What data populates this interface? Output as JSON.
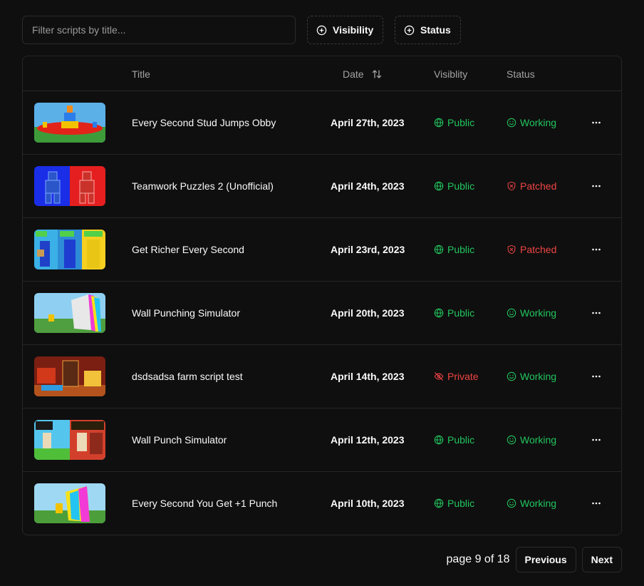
{
  "filters": {
    "search_placeholder": "Filter scripts by title...",
    "visibility_label": "Visibility",
    "status_label": "Status"
  },
  "table": {
    "headers": {
      "title": "Title",
      "date": "Date",
      "visibility": "Visiblity",
      "status": "Status"
    },
    "rows": [
      {
        "title": "Every Second Stud Jumps Obby",
        "date": "April 27th, 2023",
        "visibility": "Public",
        "status": "Working",
        "thumb": "stud-obby-thumbnail"
      },
      {
        "title": "Teamwork Puzzles 2 (Unofficial)",
        "date": "April 24th, 2023",
        "visibility": "Public",
        "status": "Patched",
        "thumb": "teamwork-puzzles-thumbnail"
      },
      {
        "title": "Get Richer Every Second",
        "date": "April 23rd, 2023",
        "visibility": "Public",
        "status": "Patched",
        "thumb": "get-richer-thumbnail"
      },
      {
        "title": "Wall Punching Simulator",
        "date": "April 20th, 2023",
        "visibility": "Public",
        "status": "Working",
        "thumb": "wall-punching-thumbnail"
      },
      {
        "title": "dsdsadsa farm script test",
        "date": "April 14th, 2023",
        "visibility": "Private",
        "status": "Working",
        "thumb": "farm-script-thumbnail"
      },
      {
        "title": "Wall Punch Simulator",
        "date": "April 12th, 2023",
        "visibility": "Public",
        "status": "Working",
        "thumb": "wall-punch-thumbnail"
      },
      {
        "title": "Every Second You Get +1 Punch",
        "date": "April 10th, 2023",
        "visibility": "Public",
        "status": "Working",
        "thumb": "plus-one-punch-thumbnail"
      }
    ]
  },
  "pagination": {
    "label": "page 9 of 18",
    "previous_label": "Previous",
    "next_label": "Next"
  },
  "colors": {
    "background": "#0f0f0f",
    "border": "#262626",
    "green": "#22c55e",
    "red": "#ef4444",
    "muted": "#a3a3a3"
  }
}
